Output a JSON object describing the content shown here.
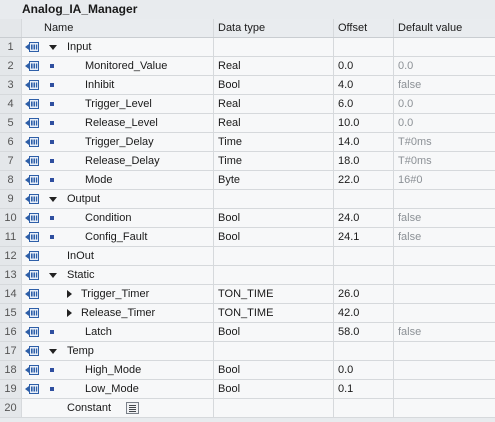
{
  "block": {
    "title": "Analog_IA_Manager"
  },
  "columns": {
    "name": "Name",
    "type": "Data type",
    "offset": "Offset",
    "default": "Default value"
  },
  "rows": [
    {
      "num": "1",
      "name": "Input",
      "type": "",
      "offset": "",
      "default": ""
    },
    {
      "num": "2",
      "name": "Monitored_Value",
      "type": "Real",
      "offset": "0.0",
      "default": "0.0"
    },
    {
      "num": "3",
      "name": "Inhibit",
      "type": "Bool",
      "offset": "4.0",
      "default": "false"
    },
    {
      "num": "4",
      "name": "Trigger_Level",
      "type": "Real",
      "offset": "6.0",
      "default": "0.0"
    },
    {
      "num": "5",
      "name": "Release_Level",
      "type": "Real",
      "offset": "10.0",
      "default": "0.0"
    },
    {
      "num": "6",
      "name": "Trigger_Delay",
      "type": "Time",
      "offset": "14.0",
      "default": "T#0ms"
    },
    {
      "num": "7",
      "name": "Release_Delay",
      "type": "Time",
      "offset": "18.0",
      "default": "T#0ms"
    },
    {
      "num": "8",
      "name": "Mode",
      "type": "Byte",
      "offset": "22.0",
      "default": "16#0"
    },
    {
      "num": "9",
      "name": "Output",
      "type": "",
      "offset": "",
      "default": ""
    },
    {
      "num": "10",
      "name": "Condition",
      "type": "Bool",
      "offset": "24.0",
      "default": "false"
    },
    {
      "num": "11",
      "name": "Config_Fault",
      "type": "Bool",
      "offset": "24.1",
      "default": "false"
    },
    {
      "num": "12",
      "name": "InOut",
      "type": "",
      "offset": "",
      "default": ""
    },
    {
      "num": "13",
      "name": "Static",
      "type": "",
      "offset": "",
      "default": ""
    },
    {
      "num": "14",
      "name": "Trigger_Timer",
      "type": "TON_TIME",
      "offset": "26.0",
      "default": ""
    },
    {
      "num": "15",
      "name": "Release_Timer",
      "type": "TON_TIME",
      "offset": "42.0",
      "default": ""
    },
    {
      "num": "16",
      "name": "Latch",
      "type": "Bool",
      "offset": "58.0",
      "default": "false"
    },
    {
      "num": "17",
      "name": "Temp",
      "type": "",
      "offset": "",
      "default": ""
    },
    {
      "num": "18",
      "name": "High_Mode",
      "type": "Bool",
      "offset": "0.0",
      "default": ""
    },
    {
      "num": "19",
      "name": "Low_Mode",
      "type": "Bool",
      "offset": "0.1",
      "default": ""
    },
    {
      "num": "20",
      "name": "Constant",
      "type": "",
      "offset": "",
      "default": ""
    }
  ],
  "icons": {
    "interface": "interface-icon",
    "type_picker": "type-picker-icon"
  },
  "colors": {
    "icon_blue": "#2e5fa8",
    "bullet": "#2f4f9f",
    "gray_text": "#8c9196"
  }
}
